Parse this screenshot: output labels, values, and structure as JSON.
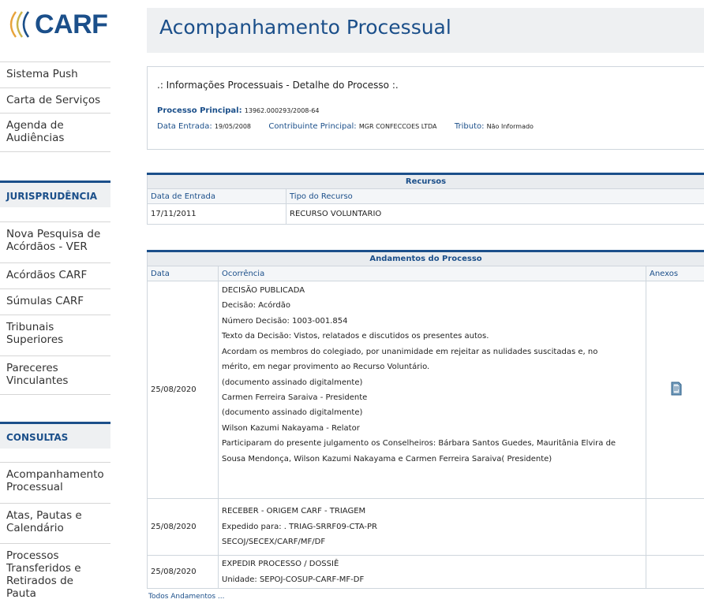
{
  "logo": {
    "text": "CARF"
  },
  "sidebar": {
    "top_items": [
      {
        "label": "Sistema Push"
      },
      {
        "label": "Carta de Serviços"
      },
      {
        "label": "Agenda de Audiências"
      }
    ],
    "jurisprudencia": {
      "header": "JURISPRUDÊNCIA",
      "items": [
        {
          "label": "Nova Pesquisa de Acórdãos - VER"
        },
        {
          "label": "Acórdãos CARF"
        },
        {
          "label": "Súmulas CARF"
        },
        {
          "label": "Tribunais Superiores"
        },
        {
          "label": "Pareceres Vinculantes"
        }
      ]
    },
    "consultas": {
      "header": "CONSULTAS",
      "items": [
        {
          "label": "Acompanhamento Processual"
        },
        {
          "label": "Atas, Pautas e Calendário"
        },
        {
          "label": "Processos Transferidos e Retirados de Pauta"
        }
      ]
    }
  },
  "page": {
    "title": "Acompanhamento Processual"
  },
  "info": {
    "title": ".: Informações Processuais - Detalhe do Processo :.",
    "processo_label": "Processo Principal:",
    "processo_value": "13962.000293/2008-64",
    "data_entrada_label": "Data Entrada:",
    "data_entrada_value": "19/05/2008",
    "contribuinte_label": "Contribuinte Principal:",
    "contribuinte_value": "MGR CONFECCOES LTDA",
    "tributo_label": "Tributo:",
    "tributo_value": "Não Informado"
  },
  "recursos": {
    "caption": "Recursos",
    "headers": [
      "Data de Entrada",
      "Tipo do Recurso"
    ],
    "rows": [
      {
        "data": "17/11/2011",
        "tipo": "RECURSO VOLUNTARIO"
      }
    ]
  },
  "andamentos": {
    "caption": "Andamentos do Processo",
    "headers": [
      "Data",
      "Ocorrência",
      "Anexos"
    ],
    "rows": [
      {
        "data": "25/08/2020",
        "lines": [
          "DECISÃO PUBLICADA",
          "Decisão: Acórdão",
          "Número Decisão: 1003-001.854",
          "Texto da Decisão: Vistos, relatados e discutidos os presentes autos.",
          "Acordam os membros do colegiado, por unanimidade em rejeitar as nulidades suscitadas e, no",
          "mérito, em negar provimento ao Recurso Voluntário.",
          "(documento assinado digitalmente)",
          "Carmen Ferreira Saraiva - Presidente",
          "(documento assinado digitalmente)",
          "Wilson Kazumi Nakayama - Relator",
          "Participaram do presente julgamento os Conselheiros: Bárbara Santos Guedes, Mauritânia Elvira de",
          "Sousa Mendonça, Wilson Kazumi Nakayama e Carmen Ferreira Saraiva( Presidente)"
        ],
        "anexo_icon": "document-attachment-icon"
      },
      {
        "data": "25/08/2020",
        "lines": [
          "RECEBER - ORIGEM CARF - TRIAGEM",
          "Expedido para: . TRIAG-SRRF09-CTA-PR",
          "SECOJ/SECEX/CARF/MF/DF"
        ]
      },
      {
        "data": "25/08/2020",
        "lines": [
          "EXPEDIR PROCESSO / DOSSIÊ",
          "Unidade: SEPOJ-COSUP-CARF-MF-DF"
        ]
      }
    ],
    "all_link": "Todos Andamentos ..."
  },
  "colors": {
    "brand": "#1b4f8a",
    "logo_arc": "#e8a33b"
  }
}
